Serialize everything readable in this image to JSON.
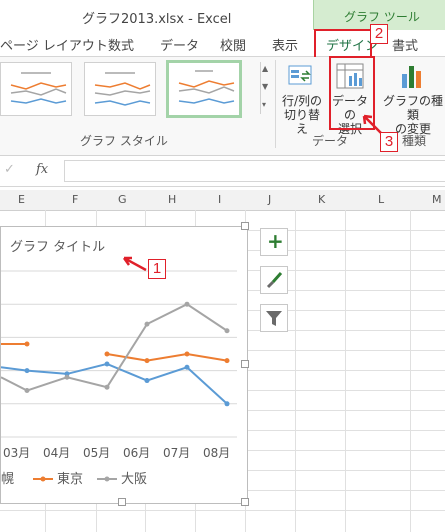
{
  "window": {
    "title": "グラフ2013.xlsx - Excel"
  },
  "context_tab": {
    "label": "グラフ ツール"
  },
  "tabs": [
    "ページ レイアウト",
    "数式",
    "データ",
    "校閲",
    "表示",
    "デザイン",
    "書式"
  ],
  "active_tab": "デザイン",
  "ribbon": {
    "group_styles": "グラフ スタイル",
    "group_data": "データ",
    "group_type": "種類",
    "switch_row_col": [
      "行/列の",
      "切り替え"
    ],
    "select_data": [
      "データの",
      "選択"
    ],
    "change_type": [
      "グラフの種類",
      "の変更"
    ]
  },
  "formula_bar": {
    "fx": "fx",
    "check": "✓"
  },
  "columns": [
    "E",
    "F",
    "G",
    "H",
    "I",
    "J",
    "K",
    "L",
    "M"
  ],
  "callouts": [
    "1",
    "2",
    "3"
  ],
  "colors": {
    "accent_green": "#2e7d32",
    "callout_red": "#e0202a",
    "tokyo": "#ed7d31",
    "osaka": "#a5a5a5",
    "sapporo": "#5b9bd5"
  },
  "chart_data": {
    "type": "line",
    "title": "グラフ タイトル",
    "categories": [
      "03月",
      "04月",
      "05月",
      "06月",
      "07月",
      "08月"
    ],
    "series": [
      {
        "name": "札幌",
        "values": [
          null,
          null,
          null,
          null,
          null,
          null
        ]
      },
      {
        "name": "東京",
        "values": [
          0.8,
          null,
          0.5,
          0.3,
          0.5,
          0.3
        ]
      },
      {
        "name": "大阪",
        "values": [
          -0.6,
          -0.2,
          -0.5,
          1.4,
          2.0,
          1.2
        ]
      }
    ],
    "legend_entries": [
      "幌",
      "東京",
      "大阪"
    ],
    "legend_position": "bottom",
    "grid": true
  }
}
